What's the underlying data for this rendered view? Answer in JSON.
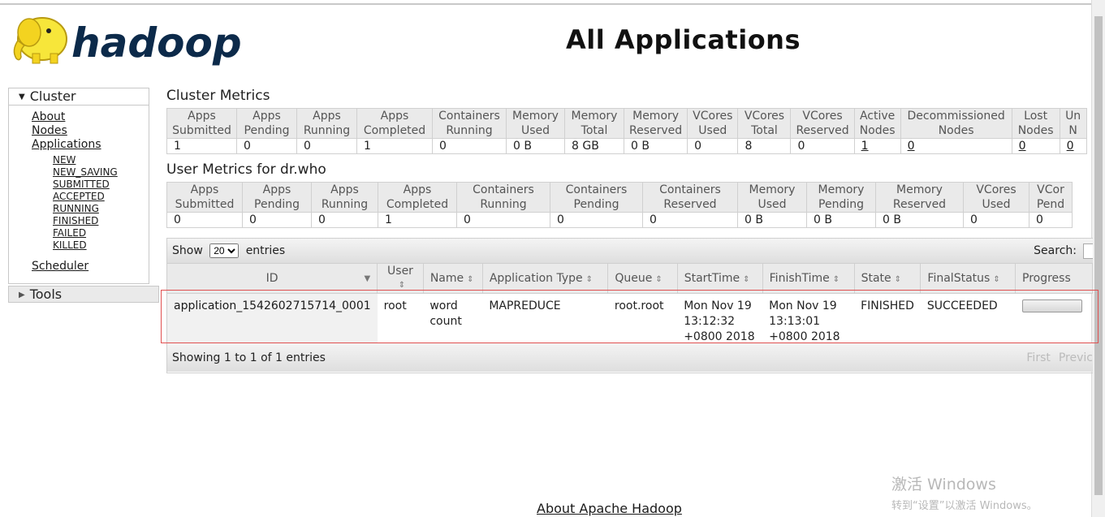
{
  "header": {
    "logo_text": "hadoop",
    "title": "All Applications"
  },
  "nav": {
    "cluster_label": "Cluster",
    "links": [
      "About",
      "Nodes",
      "Applications"
    ],
    "app_states": [
      "NEW",
      "NEW_SAVING",
      "SUBMITTED",
      "ACCEPTED",
      "RUNNING",
      "FINISHED",
      "FAILED",
      "KILLED"
    ],
    "scheduler": "Scheduler",
    "tools_label": "Tools"
  },
  "cluster_metrics": {
    "title": "Cluster Metrics",
    "headers": [
      [
        "Apps",
        "Submitted"
      ],
      [
        "Apps",
        "Pending"
      ],
      [
        "Apps",
        "Running"
      ],
      [
        "Apps",
        "Completed"
      ],
      [
        "Containers",
        "Running"
      ],
      [
        "Memory",
        "Used"
      ],
      [
        "Memory",
        "Total"
      ],
      [
        "Memory",
        "Reserved"
      ],
      [
        "VCores",
        "Used"
      ],
      [
        "VCores",
        "Total"
      ],
      [
        "VCores",
        "Reserved"
      ],
      [
        "Active",
        "Nodes"
      ],
      [
        "Decommissioned",
        "Nodes"
      ],
      [
        "Lost",
        "Nodes"
      ],
      [
        "Un",
        "N"
      ]
    ],
    "values": [
      "1",
      "0",
      "0",
      "1",
      "0",
      "0 B",
      "8 GB",
      "0 B",
      "0",
      "8",
      "0",
      "1",
      "0",
      "0",
      "0"
    ]
  },
  "user_metrics": {
    "title": "User Metrics for dr.who",
    "headers": [
      [
        "Apps",
        "Submitted"
      ],
      [
        "Apps",
        "Pending"
      ],
      [
        "Apps",
        "Running"
      ],
      [
        "Apps",
        "Completed"
      ],
      [
        "Containers",
        "Running"
      ],
      [
        "Containers",
        "Pending"
      ],
      [
        "Containers",
        "Reserved"
      ],
      [
        "Memory",
        "Used"
      ],
      [
        "Memory",
        "Pending"
      ],
      [
        "Memory",
        "Reserved"
      ],
      [
        "VCores",
        "Used"
      ],
      [
        "VCor",
        "Pend"
      ]
    ],
    "values": [
      "0",
      "0",
      "0",
      "1",
      "0",
      "0",
      "0",
      "0 B",
      "0 B",
      "0 B",
      "0",
      "0"
    ]
  },
  "apps_table": {
    "show_label": "Show",
    "page_size": "20",
    "entries_label": "entries",
    "search_label": "Search:",
    "columns": [
      "ID",
      "User",
      "Name",
      "Application Type",
      "Queue",
      "StartTime",
      "FinishTime",
      "State",
      "FinalStatus",
      "Progress"
    ],
    "rows": [
      {
        "id": "application_1542602715714_0001",
        "user": "root",
        "name": "word count",
        "type": "MAPREDUCE",
        "queue": "root.root",
        "start": "Mon Nov 19 13:12:32 +0800 2018",
        "finish": "Mon Nov 19 13:13:01 +0800 2018",
        "state": "FINISHED",
        "final_status": "SUCCEEDED"
      }
    ],
    "footer_info": "Showing 1 to 1 of 1 entries",
    "pager": [
      "First",
      "Previc"
    ]
  },
  "footer": {
    "about_link": "About Apache Hadoop"
  },
  "watermark": {
    "line1": "激活 Windows",
    "line2": "转到“设置”以激活 Windows。"
  }
}
